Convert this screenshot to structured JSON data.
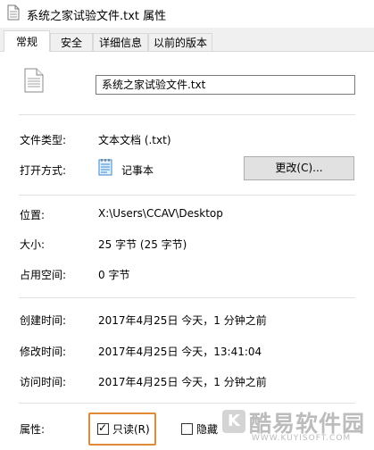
{
  "window": {
    "title": "系统之家试验文件.txt 属性"
  },
  "tabs": [
    {
      "label": "常规",
      "active": true
    },
    {
      "label": "安全",
      "active": false
    },
    {
      "label": "详细信息",
      "active": false
    },
    {
      "label": "以前的版本",
      "active": false
    }
  ],
  "file": {
    "name": "系统之家试验文件.txt",
    "icon": "text-file-icon"
  },
  "type": {
    "label": "文件类型:",
    "value": "文本文档 (.txt)"
  },
  "opens_with": {
    "label": "打开方式:",
    "app_name": "记事本",
    "app_icon": "notepad-icon",
    "change_button": "更改(C)..."
  },
  "location": {
    "label": "位置:",
    "value": "X:\\Users\\CCAV\\Desktop"
  },
  "size": {
    "label": "大小:",
    "value": "25 字节 (25 字节)"
  },
  "size_on_disk": {
    "label": "占用空间:",
    "value": "0 字节"
  },
  "created": {
    "label": "创建时间:",
    "value": "2017年4月25日 今天，1 分钟之前"
  },
  "modified": {
    "label": "修改时间:",
    "value": "2017年4月25日 今天，13:41:04"
  },
  "accessed": {
    "label": "访问时间:",
    "value": "2017年4月25日 今天，1 分钟之前"
  },
  "attributes": {
    "label": "属性:",
    "readonly_label": "只读(R)",
    "readonly_checked": true,
    "hidden_label": "隐藏",
    "hidden_checked": false
  },
  "watermark": {
    "badge": "K",
    "text": "酷易软件园",
    "url": "WWW.KUYISOFT.COM"
  },
  "colors": {
    "highlight": "#e08a35",
    "separator": "#e0e0e0",
    "button_bg": "#e1e1e1"
  }
}
